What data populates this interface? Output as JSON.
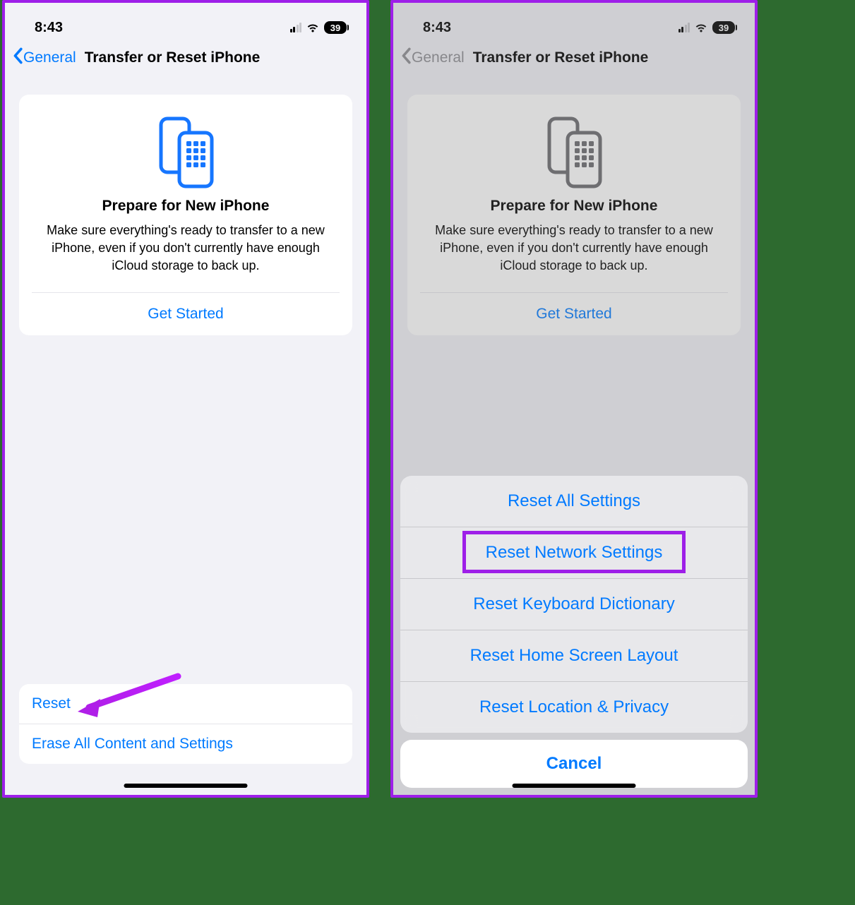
{
  "statusbar": {
    "time": "8:43",
    "battery_percent": "39"
  },
  "nav": {
    "back_label": "General",
    "title": "Transfer or Reset iPhone"
  },
  "prepare_card": {
    "title": "Prepare for New iPhone",
    "description": "Make sure everything's ready to transfer to a new iPhone, even if you don't currently have enough iCloud storage to back up.",
    "get_started": "Get Started"
  },
  "bottom_list": {
    "reset": "Reset",
    "erase": "Erase All Content and Settings"
  },
  "action_sheet": {
    "items": [
      "Reset All Settings",
      "Reset Network Settings",
      "Reset Keyboard Dictionary",
      "Reset Home Screen Layout",
      "Reset Location & Privacy"
    ],
    "cancel": "Cancel",
    "highlighted_index": 1
  },
  "colors": {
    "ios_blue": "#007aff",
    "annotation_purple": "#9e1fe8",
    "bg_grouped": "#f2f2f7"
  }
}
